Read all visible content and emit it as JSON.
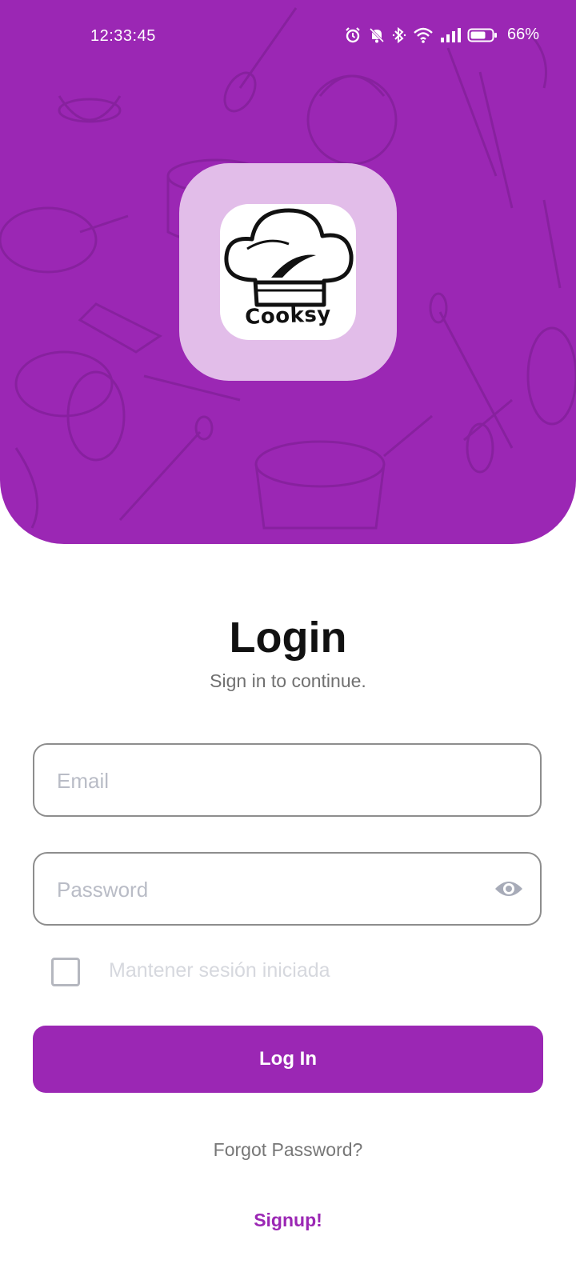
{
  "status_bar": {
    "time": "12:33:45",
    "battery_percent": "66%",
    "icons": [
      "alarm-icon",
      "bell-muted-icon",
      "bluetooth-icon",
      "wifi-icon",
      "signal-icon",
      "battery-icon"
    ]
  },
  "brand": {
    "app_name": "Cooksy",
    "primary_color": "#9b27b4",
    "logo_icon": "chef-hat-icon"
  },
  "login": {
    "title": "Login",
    "subtitle": "Sign in to continue.",
    "email_placeholder": "Email",
    "password_placeholder": "Password",
    "password_visibility_icon": "eye-icon",
    "remember_label": "Mantener sesión iniciada",
    "remember_checked": false,
    "login_button": "Log In",
    "forgot_password": "Forgot Password?",
    "signup": "Signup!"
  }
}
